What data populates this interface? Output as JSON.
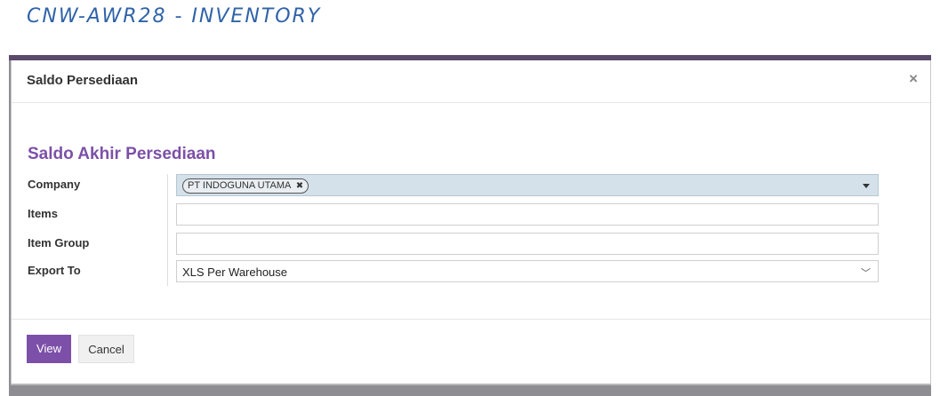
{
  "page_heading": "CNW-AWR28 - INVENTORY",
  "modal": {
    "title": "Saldo Persediaan",
    "close_symbol": "×"
  },
  "section_title": "Saldo Akhir Persediaan",
  "form": {
    "company": {
      "label": "Company",
      "tag": "PT INDOGUNA UTAMA",
      "tag_remove_symbol": "✖"
    },
    "items": {
      "label": "Items",
      "value": ""
    },
    "item_group": {
      "label": "Item Group",
      "value": ""
    },
    "export_to": {
      "label": "Export To",
      "selected": "XLS Per Warehouse",
      "chevron": "﹀"
    }
  },
  "footer": {
    "view_label": "View",
    "cancel_label": "Cancel"
  },
  "colors": {
    "accent": "#7c50a8",
    "heading_blue": "#2f63a8",
    "company_field_bg": "#d4e1ea"
  }
}
